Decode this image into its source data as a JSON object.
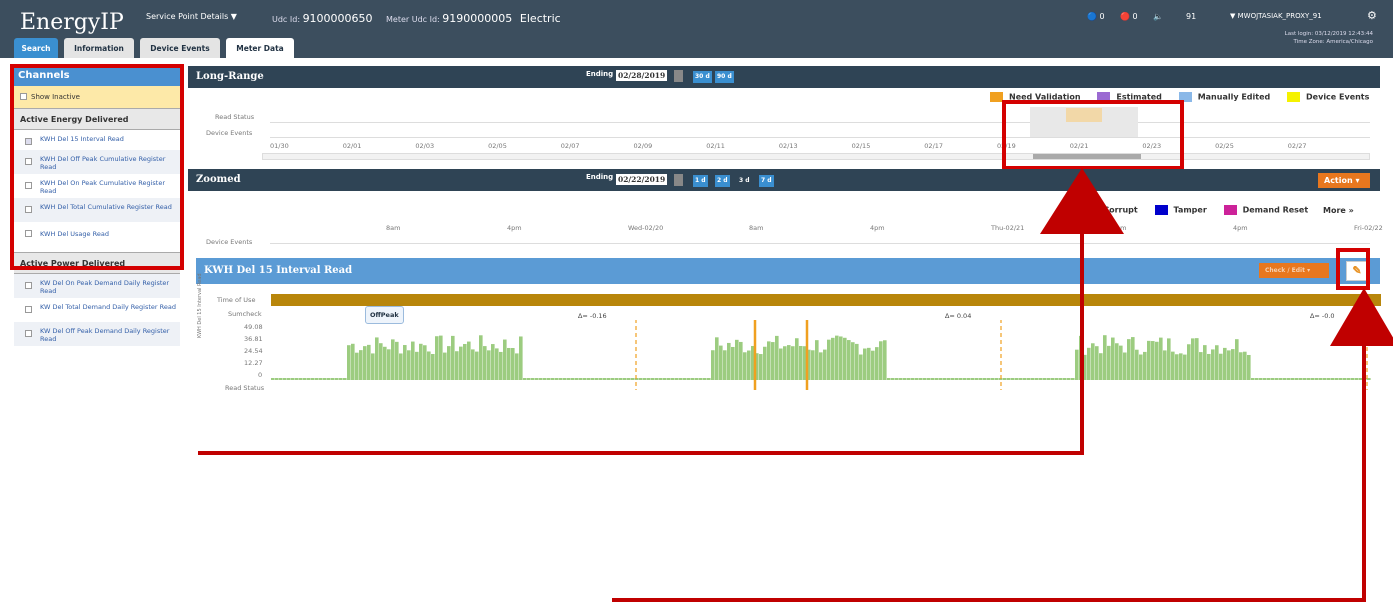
{
  "header": {
    "logo": "EnergyIP",
    "service_point": "Service Point Details ▼",
    "udc_label": "Udc Id:",
    "udc_id": "9100000650",
    "meter_label": "Meter Udc Id:",
    "meter_id": "9190000005",
    "commodity": "Electric",
    "alerts_blue": "0",
    "alerts_red": "0",
    "volume": "🔈",
    "count": "91",
    "user": "▼  MWOJTASIAK_PROXY_91",
    "last_login": "Last login: 03/12/2019 12:43:44",
    "time_zone": "Time Zone: America/Chicago"
  },
  "tabs": [
    "Search",
    "Information",
    "Device Events",
    "Meter Data"
  ],
  "channels": {
    "title": "Channels",
    "show_inactive": "Show Inactive",
    "energy_group": "Active Energy Delivered",
    "energy": [
      "KWH Del 15 Interval Read",
      "KWH Del Off Peak Cumulative Register Read",
      "KWH Del On Peak Cumulative Register Read",
      "KWH Del Total Cumulative Register Read",
      "KWH Del Usage Read"
    ],
    "power_group": "Active Power Delivered",
    "power": [
      "KW Del On Peak Demand Daily Register Read",
      "KW Del Total Demand Daily Register Read",
      "KW Del Off Peak Demand Daily Register Read"
    ]
  },
  "long_range": {
    "title": "Long-Range",
    "ending_label": "Ending",
    "ending": "02/28/2019",
    "btn1": "30 d",
    "btn2": "90 d",
    "legend": [
      "Need Validation",
      "Estimated",
      "Manually Edited",
      "Device Events"
    ],
    "legend_colors": [
      "#f0a020",
      "#9b6ad2",
      "#8ab8e8",
      "#f5f200"
    ],
    "row1": "Read Status",
    "row2": "Device Events",
    "ticks": [
      "01/30",
      "02/01",
      "02/03",
      "02/05",
      "02/07",
      "02/09",
      "02/11",
      "02/13",
      "02/15",
      "02/17",
      "02/19",
      "02/21",
      "02/23",
      "02/25",
      "02/27"
    ]
  },
  "zoomed": {
    "title": "Zoomed",
    "ending_label": "Ending",
    "ending": "02/22/2019",
    "btns": [
      "1 d",
      "2 d",
      "3 d",
      "7 d"
    ],
    "action": "Action ▾",
    "legend": [
      "Corrupt",
      "Tamper",
      "Demand Reset",
      "More »"
    ],
    "legend_prefix": "a",
    "row": "Device Events",
    "ticks": [
      "8am",
      "4pm",
      "Wed-02/20",
      "8am",
      "4pm",
      "Thu-02/21",
      "8am",
      "4pm",
      "Fri-02/22"
    ]
  },
  "interval": {
    "title": "KWH Del 15 Interval Read",
    "check": "Check / Edit ▾",
    "tou": "Time of Use",
    "sumcheck": "Sumcheck",
    "tooltip": "OffPeak",
    "deltas": [
      "∆= -0.16",
      "∆= 0.04",
      "∆= -0.0"
    ],
    "y_ticks": [
      "49.08",
      "36.81",
      "24.54",
      "12.27",
      "0"
    ],
    "ylabel": "KWH Del 15 Interval Read",
    "read_status": "Read Status"
  },
  "colors": {
    "top": "#3c4e5e",
    "accent": "#3a8fd0",
    "red": "#d40000",
    "tou": "#b8860b",
    "bars": "#9ccc80"
  }
}
